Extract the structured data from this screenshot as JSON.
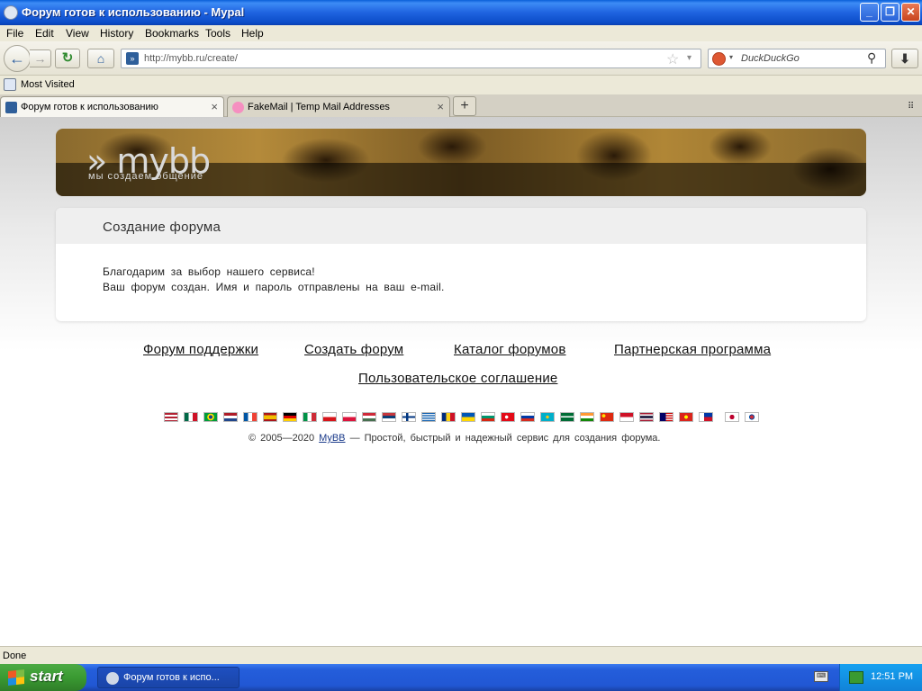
{
  "window": {
    "title": "Форум готов к использованию - Mypal",
    "minimize": "_",
    "maximize": "❐",
    "close": "✕"
  },
  "menu": [
    "File",
    "Edit",
    "View",
    "History",
    "Bookmarks",
    "Tools",
    "Help"
  ],
  "nav": {
    "back": "←",
    "forward": "→",
    "reload": "↻",
    "home": "⌂",
    "url": "http://mybb.ru/create/",
    "star": "☆",
    "dropdown": "▾",
    "search_placeholder": "DuckDuckGo",
    "search_icon": "⚲",
    "download": "⬇"
  },
  "bookmarks": {
    "item": "Most Visited"
  },
  "tabs": [
    {
      "title": "Форум готов к использованию",
      "close": "×"
    },
    {
      "title": "FakeMail | Temp Mail Addresses",
      "close": "×"
    }
  ],
  "new_tab": "+",
  "tab_list": "⠿",
  "banner": {
    "logo": "» mybb",
    "tagline": "мы  создаем  общение"
  },
  "panel": {
    "title": "Создание форума",
    "line1": "Благодарим за выбор нашего сервиса!",
    "line2": "Ваш форум создан. Имя и пароль отправлены на ваш e-mail."
  },
  "footer_links": [
    "Форум поддержки",
    "Создать форум",
    "Каталог форумов",
    "Партнерская программа",
    "Пользовательское соглашение"
  ],
  "flags": [
    "us",
    "mx",
    "br",
    "nl",
    "fr",
    "es",
    "de",
    "it",
    "cz",
    "pl",
    "hu",
    "rs",
    "fi",
    "gr",
    "ro",
    "ua",
    "bg",
    "tr",
    "ru",
    "kz",
    "sa",
    "in",
    "cn",
    "id",
    "th",
    "my",
    "vn",
    "ph",
    "jp",
    "kr"
  ],
  "copyright": {
    "prefix": "© 2005—2020",
    "link": "MyBB",
    "suffix": "— Простой, быстрый и надежный сервис для создания форума."
  },
  "status": "Done",
  "taskbar": {
    "start": "start",
    "task": "Форум готов к испо...",
    "clock": "12:51 PM"
  }
}
